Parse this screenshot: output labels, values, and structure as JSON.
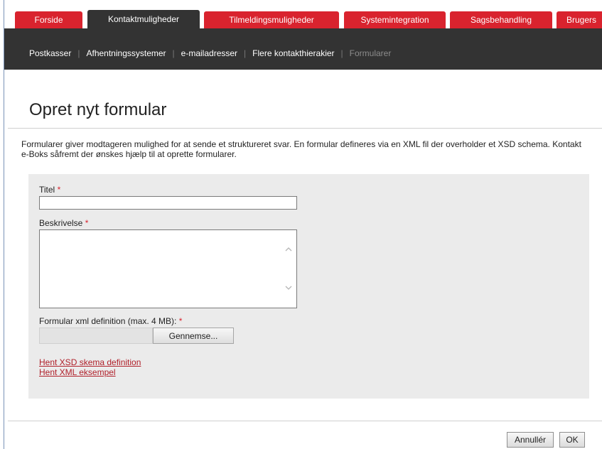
{
  "tabs": [
    {
      "label": "Forside",
      "active": false
    },
    {
      "label": "Kontaktmuligheder",
      "active": true
    },
    {
      "label": "Tilmeldingsmuligheder",
      "active": false
    },
    {
      "label": "Systemintegration",
      "active": false
    },
    {
      "label": "Sagsbehandling",
      "active": false
    },
    {
      "label": "Brugers",
      "active": false
    }
  ],
  "subnav": [
    {
      "label": "Postkasser"
    },
    {
      "label": "Afhentningssystemer"
    },
    {
      "label": "e-mailadresser"
    },
    {
      "label": "Flere kontakthierakier"
    },
    {
      "label": "Formularer",
      "current": true
    }
  ],
  "page": {
    "title": "Opret nyt formular",
    "intro": "Formularer giver modtageren mulighed for at sende et struktureret svar. En formular defineres via en XML fil der overholder et XSD schema. Kontakt e-Boks såfremt der ønskes hjælp til at oprette formularer."
  },
  "form": {
    "titel_label": "Titel",
    "titel_value": "",
    "beskrivelse_label": "Beskrivelse",
    "beskrivelse_value": "",
    "required_mark": "*",
    "file_label": "Formular xml definition (max. 4 MB):",
    "file_value": "",
    "browse_label": "Gennemse...",
    "link_xsd": "Hent XSD skema definition",
    "link_xml": "Hent XML eksempel"
  },
  "footer": {
    "cancel_label": "Annullér",
    "ok_label": "OK"
  },
  "colors": {
    "tab_red": "#d9232e",
    "nav_dark": "#333333",
    "panel_grey": "#ebebeb",
    "link_red": "#b0202a"
  },
  "icons": {
    "scroll_up": "chevron-up-icon",
    "scroll_down": "chevron-down-icon"
  }
}
